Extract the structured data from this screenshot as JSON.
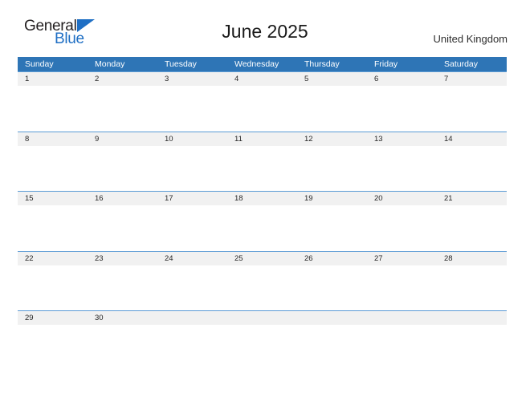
{
  "brand": {
    "name_top": "General",
    "name_bottom": "Blue",
    "triangle_icon": "triangle-icon",
    "accent_color": "#1f6fc4"
  },
  "header": {
    "title": "June 2025",
    "country": "United Kingdom"
  },
  "theme": {
    "header_blue": "#2e75b6",
    "row_border_blue": "#5b9bd5",
    "date_band_gray": "#f1f1f1",
    "text_dark": "#262626",
    "background": "#ffffff"
  },
  "calendar": {
    "month": "June",
    "year": "2025",
    "weekdays": [
      "Sunday",
      "Monday",
      "Tuesday",
      "Wednesday",
      "Thursday",
      "Friday",
      "Saturday"
    ],
    "weeks": [
      [
        "1",
        "2",
        "3",
        "4",
        "5",
        "6",
        "7"
      ],
      [
        "8",
        "9",
        "10",
        "11",
        "12",
        "13",
        "14"
      ],
      [
        "15",
        "16",
        "17",
        "18",
        "19",
        "20",
        "21"
      ],
      [
        "22",
        "23",
        "24",
        "25",
        "26",
        "27",
        "28"
      ],
      [
        "29",
        "30",
        "",
        "",
        "",
        "",
        ""
      ]
    ]
  }
}
